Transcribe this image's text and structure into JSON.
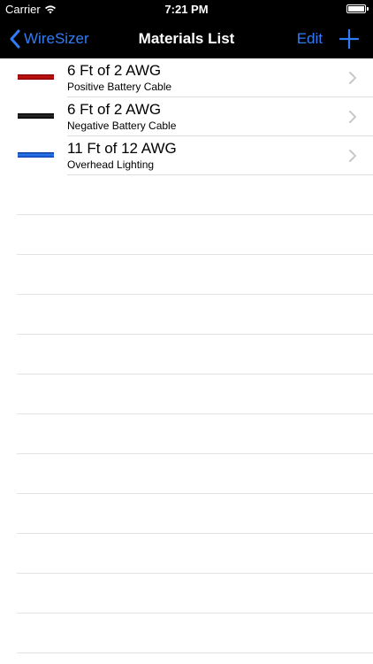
{
  "status_bar": {
    "carrier": "Carrier",
    "wifi_icon": "wifi-icon",
    "time": "7:21 PM",
    "battery_icon": "battery-icon"
  },
  "nav_bar": {
    "back_label": "WireSizer",
    "back_icon": "chevron-left-icon",
    "title": "Materials List",
    "edit_label": "Edit",
    "add_icon": "plus-icon",
    "accent_color": "#2f7cf6",
    "background_color": "#000000"
  },
  "materials": [
    {
      "title": "6 Ft of 2 AWG",
      "subtitle": "Positive Battery Cable",
      "wire_color": "#b00000"
    },
    {
      "title": "6 Ft of 2 AWG",
      "subtitle": "Negative Battery Cable",
      "wire_color": "#000000"
    },
    {
      "title": "11 Ft of 12 AWG",
      "subtitle": "Overhead Lighting",
      "wire_color": "#0a4fd1"
    }
  ]
}
